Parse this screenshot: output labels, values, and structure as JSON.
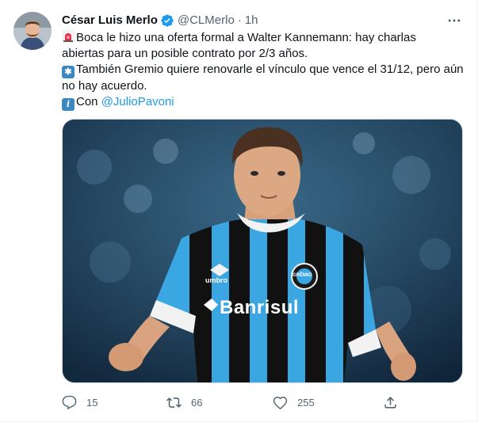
{
  "author": {
    "name": "César Luis Merlo",
    "handle": "@CLMerlo",
    "separator": "·",
    "time": "1h",
    "verified": true
  },
  "tweet": {
    "line1": "Boca le hizo una oferta formal a Walter Kannemann: hay charlas",
    "line2": "abiertas para un posible contrato por 2/3 años.",
    "line3": "También Gremio quiere renovarle el vínculo que vence el 31/12, pero aún",
    "line4": "no hay acuerdo.",
    "line5_prefix": "Con ",
    "mention": "@JulioPavoni",
    "emojis": [
      "police-siren-icon",
      "asterisk-icon",
      "information-icon"
    ]
  },
  "media": {
    "jersey_text": "Banrisul",
    "brand_text": "umbro",
    "crest_text": "GRÊMIO"
  },
  "actions": {
    "replies": "15",
    "retweets": "66",
    "likes": "255"
  },
  "colors": {
    "accent": "#1d9bf0",
    "muted": "#536471",
    "jersey_blue": "#3aa6e2",
    "jersey_black": "#111111"
  }
}
